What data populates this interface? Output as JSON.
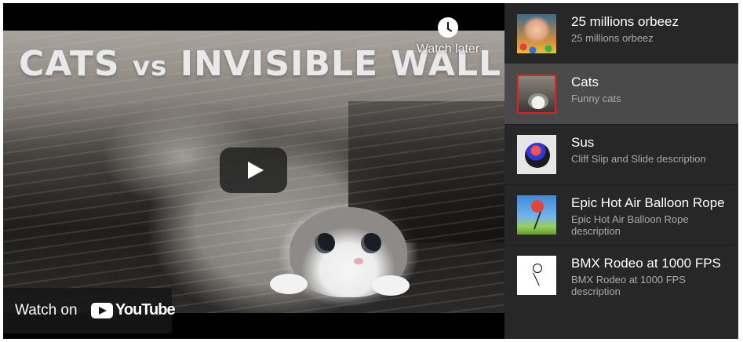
{
  "video": {
    "thumbnail_title": "CATS",
    "thumbnail_vs": "vs",
    "thumbnail_title_2": "INVISIBLE WALL",
    "watch_later_label": "Watch later",
    "watch_later_icon": "clock-icon",
    "play_icon": "play-icon",
    "watch_on_label": "Watch on",
    "youtube_wordmark": "YouTube",
    "youtube_icon": "youtube-logo-icon"
  },
  "playlist": {
    "items": [
      {
        "title": "25 millions orbeez",
        "description": "25 millions orbeez",
        "active": false
      },
      {
        "title": "Cats",
        "description": "Funny cats",
        "active": true
      },
      {
        "title": "Sus",
        "description": "Cliff Slip and Slide description",
        "active": false
      },
      {
        "title": "Epic Hot Air Balloon Rope",
        "description": "Epic Hot Air Balloon Rope description",
        "active": false
      },
      {
        "title": "BMX Rodeo at 1000 FPS",
        "description": "BMX Rodeo at 1000 FPS description",
        "active": false
      }
    ],
    "active_color": "#e62117",
    "active_bg": "#4a4a4a",
    "bg": "#272727"
  }
}
